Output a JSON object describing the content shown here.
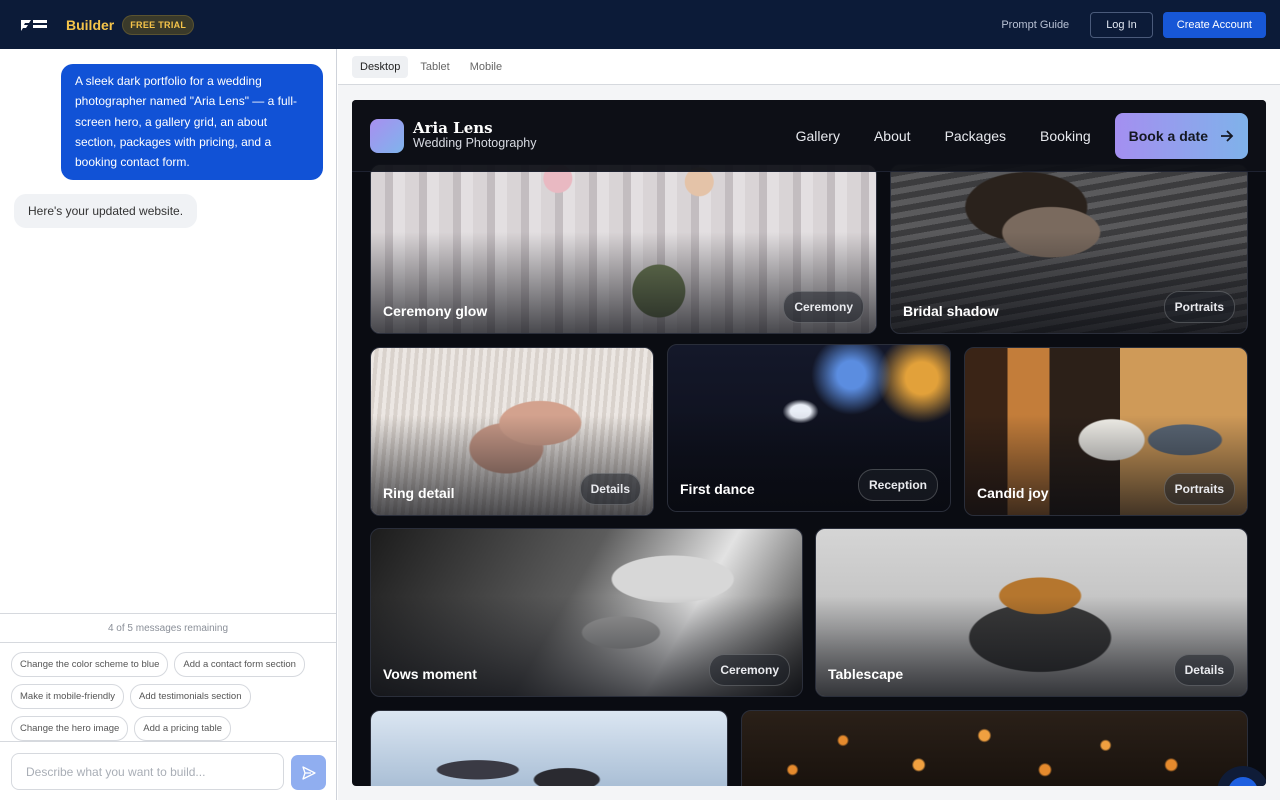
{
  "app": {
    "brand_name": "Builder",
    "trial_badge": "FREE TRIAL",
    "prompt_guide": "Prompt Guide",
    "login_label": "Log In",
    "create_account_label": "Create Account"
  },
  "chat": {
    "user_message": "A sleek dark portfolio for a wedding photographer named \"Aria Lens\" — a full-screen hero, a gallery grid, an about section, packages with pricing, and a booking contact form.",
    "bot_message": "Here's your updated website.",
    "remaining": "4 of 5 messages remaining",
    "suggestions": [
      [
        "Change the color scheme to blue",
        "Add a contact form section"
      ],
      [
        "Make it mobile-friendly",
        "Add testimonials section"
      ],
      [
        "Change the hero image",
        "Add a pricing table"
      ]
    ],
    "input_placeholder": "Describe what you want to build..."
  },
  "preview": {
    "tabs": [
      "Desktop",
      "Tablet",
      "Mobile"
    ],
    "active_tab": "Desktop"
  },
  "site": {
    "title": "Aria Lens",
    "subtitle": "Wedding Photography",
    "nav": [
      "Gallery",
      "About",
      "Packages",
      "Booking"
    ],
    "cta": "Book a date",
    "cta_icon": "arrow-right-icon",
    "gallery": [
      {
        "label": "Ceremony glow",
        "tag": "Ceremony"
      },
      {
        "label": "Bridal shadow",
        "tag": "Portraits"
      },
      {
        "label": "Ring detail",
        "tag": "Details"
      },
      {
        "label": "First dance",
        "tag": "Reception"
      },
      {
        "label": "Candid joy",
        "tag": "Portraits"
      },
      {
        "label": "Vows moment",
        "tag": "Ceremony"
      },
      {
        "label": "Tablescape",
        "tag": "Details"
      }
    ]
  },
  "colors": {
    "topbar": "#0c1b38",
    "accent": "#1757d6",
    "brand": "#f5c44a",
    "site_bg": "#0a0c12"
  }
}
